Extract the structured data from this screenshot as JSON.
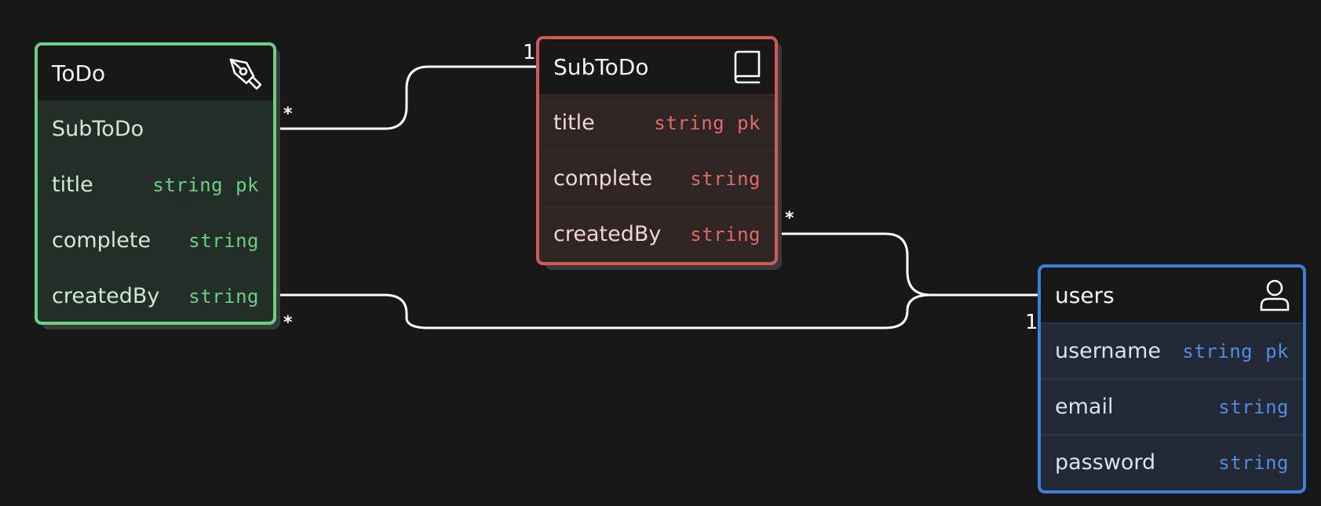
{
  "colors": {
    "background": "#181818",
    "todo_border": "#6ccf83",
    "todo_body": "#232e28",
    "todo_divider": "#1c3324",
    "todo_text": "#cfe9d7",
    "todo_type": "#6ccf83",
    "subtodo_border": "#d15a56",
    "subtodo_body": "#2f2525",
    "subtodo_divider": "#3d2828",
    "subtodo_text": "#f0d6d5",
    "subtodo_type": "#de6b66",
    "users_border": "#3f7fdc",
    "users_body": "#222834",
    "users_divider": "#2a3446",
    "users_text": "#d6e2f5",
    "users_type": "#4f8de6",
    "link": "#ffffff"
  },
  "entities": {
    "todo": {
      "title": "ToDo",
      "icon": "pen-nib-icon",
      "fields": [
        {
          "name": "SubToDo",
          "type": "",
          "pk": ""
        },
        {
          "name": "title",
          "type": "string",
          "pk": "pk"
        },
        {
          "name": "complete",
          "type": "string",
          "pk": ""
        },
        {
          "name": "createdBy",
          "type": "string",
          "pk": ""
        }
      ]
    },
    "subtodo": {
      "title": "SubToDo",
      "icon": "book-icon",
      "fields": [
        {
          "name": "title",
          "type": "string",
          "pk": "pk"
        },
        {
          "name": "complete",
          "type": "string",
          "pk": ""
        },
        {
          "name": "createdBy",
          "type": "string",
          "pk": ""
        }
      ]
    },
    "users": {
      "title": "users",
      "icon": "user-icon",
      "fields": [
        {
          "name": "username",
          "type": "string",
          "pk": "pk"
        },
        {
          "name": "email",
          "type": "string",
          "pk": ""
        },
        {
          "name": "password",
          "type": "string",
          "pk": ""
        }
      ]
    }
  },
  "relationships": [
    {
      "from": "ToDo.SubToDo",
      "from_cardinality": "*",
      "to": "SubToDo",
      "to_cardinality": "1"
    },
    {
      "from": "SubToDo.createdBy",
      "from_cardinality": "*",
      "to": "users",
      "to_cardinality": "1"
    },
    {
      "from": "ToDo.createdBy",
      "from_cardinality": "*",
      "to": "users",
      "to_cardinality": "1"
    }
  ]
}
